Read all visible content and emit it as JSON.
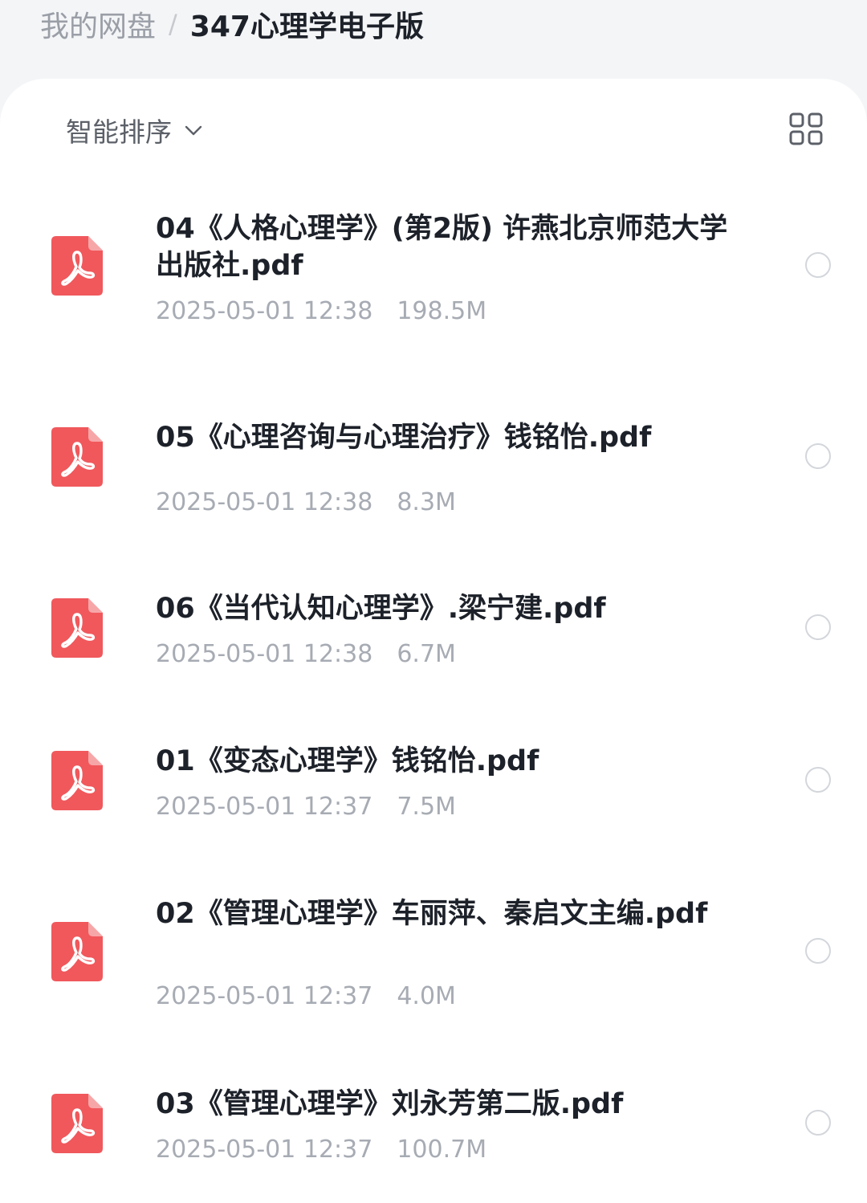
{
  "breadcrumb": {
    "root": "我的网盘",
    "separator": "/",
    "current": "347心理学电子版"
  },
  "toolbar": {
    "sort_label": "智能排序",
    "sort_icon": "chevron-down-icon",
    "view_icon": "grid-view-icon"
  },
  "colors": {
    "pdf_red": "#f0585c",
    "text_primary": "#1d2129",
    "text_secondary": "#a7abb3"
  },
  "files": [
    {
      "name": "04《人格心理学》(第2版) 许燕北京师范大学出版社.pdf",
      "date": "2025-05-01 12:38",
      "size": "198.5M",
      "type": "pdf",
      "selected": false
    },
    {
      "name": "05《心理咨询与心理治疗》钱铭怡.pdf",
      "date": "2025-05-01 12:38",
      "size": "8.3M",
      "type": "pdf",
      "selected": false
    },
    {
      "name": "06《当代认知心理学》.梁宁建.pdf",
      "date": "2025-05-01 12:38",
      "size": "6.7M",
      "type": "pdf",
      "selected": false
    },
    {
      "name": "01《变态心理学》钱铭怡.pdf",
      "date": "2025-05-01 12:37",
      "size": "7.5M",
      "type": "pdf",
      "selected": false
    },
    {
      "name": "02《管理心理学》车丽萍、秦启文主编.pdf",
      "date": "2025-05-01 12:37",
      "size": "4.0M",
      "type": "pdf",
      "selected": false
    },
    {
      "name": "03《管理心理学》刘永芳第二版.pdf",
      "date": "2025-05-01 12:37",
      "size": "100.7M",
      "type": "pdf",
      "selected": false
    }
  ]
}
